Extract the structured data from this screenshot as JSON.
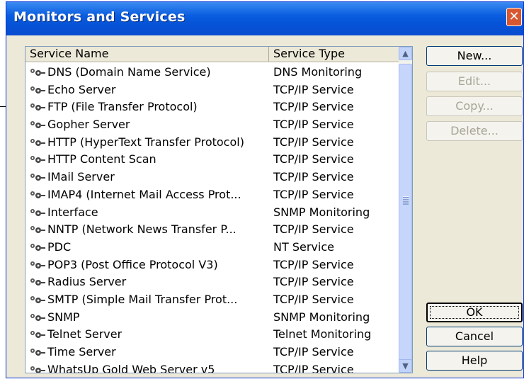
{
  "window": {
    "title": "Monitors and Services",
    "close_glyph": "✕"
  },
  "columns": {
    "name": "Service Name",
    "type": "Service Type"
  },
  "rows": [
    {
      "name": "DNS (Domain Name Service)",
      "type": "DNS Monitoring"
    },
    {
      "name": "Echo Server",
      "type": "TCP/IP Service"
    },
    {
      "name": "FTP (File Transfer Protocol)",
      "type": "TCP/IP Service"
    },
    {
      "name": "Gopher Server",
      "type": "TCP/IP Service"
    },
    {
      "name": "HTTP (HyperText Transfer Protocol)",
      "type": "TCP/IP Service"
    },
    {
      "name": "HTTP Content Scan",
      "type": "TCP/IP Service"
    },
    {
      "name": "IMail Server",
      "type": "TCP/IP Service"
    },
    {
      "name": "IMAP4 (Internet Mail Access Prot...",
      "type": "TCP/IP Service"
    },
    {
      "name": "Interface",
      "type": "SNMP Monitoring"
    },
    {
      "name": "NNTP (Network News Transfer P...",
      "type": "TCP/IP Service"
    },
    {
      "name": "PDC",
      "type": "NT Service"
    },
    {
      "name": "POP3 (Post Office Protocol V3)",
      "type": "TCP/IP Service"
    },
    {
      "name": "Radius Server",
      "type": "TCP/IP Service"
    },
    {
      "name": "SMTP (Simple Mail Transfer Prot...",
      "type": "TCP/IP Service"
    },
    {
      "name": "SNMP",
      "type": "SNMP Monitoring"
    },
    {
      "name": "Telnet Server",
      "type": "Telnet Monitoring"
    },
    {
      "name": "Time Server",
      "type": "TCP/IP Service"
    },
    {
      "name": "WhatsUp Gold Web Server v5",
      "type": "TCP/IP Service"
    }
  ],
  "buttons": {
    "new": "New...",
    "edit": "Edit...",
    "copy": "Copy...",
    "delete": "Delete...",
    "ok": "OK",
    "cancel": "Cancel",
    "help": "Help"
  },
  "scroll": {
    "up": "▲",
    "down": "▼"
  },
  "colors": {
    "titlebar": "#0a5de0",
    "close": "#d8572e",
    "dialog_bg": "#ece9d8"
  }
}
